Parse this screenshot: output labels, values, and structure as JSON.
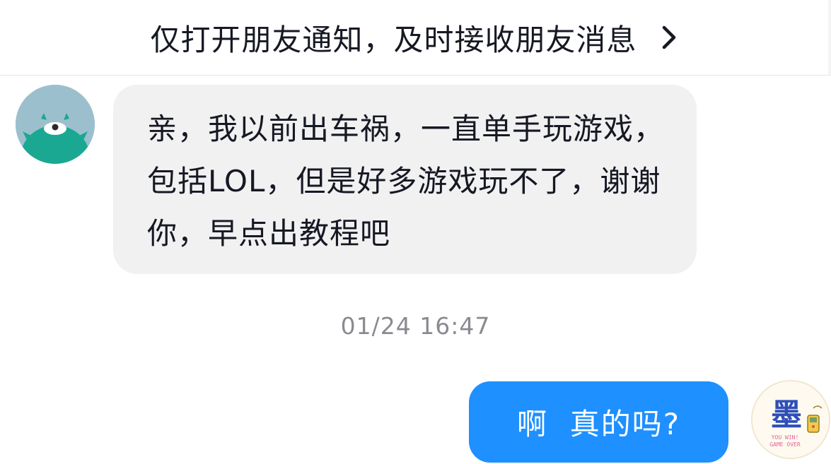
{
  "notification_bar": {
    "text": "仅打开朋友通知，及时接收朋友消息",
    "chevron_icon": "chevron-right-icon"
  },
  "messages": [
    {
      "side": "left",
      "avatar_icon": "green-monster-avatar",
      "text": "亲，我以前出车祸，一直单手玩游戏，包括LOL，但是好多游戏玩不了，谢谢你，早点出教程吧"
    },
    {
      "side": "right",
      "avatar_icon": "mo-logo-avatar",
      "text": "啊  真的吗?"
    }
  ],
  "timestamp": "01/24 16:47",
  "colors": {
    "outgoing_bubble": "#1e90ff",
    "incoming_bubble": "#f1f1f2",
    "timestamp_text": "#8a8b91",
    "avatar_left_bg": "#9cbfce",
    "avatar_left_body": "#1aa893"
  },
  "avatar_right_logo": {
    "glyph": "墨",
    "caption_line1": "YOU WIN!",
    "caption_line2": "GAME OVER"
  }
}
